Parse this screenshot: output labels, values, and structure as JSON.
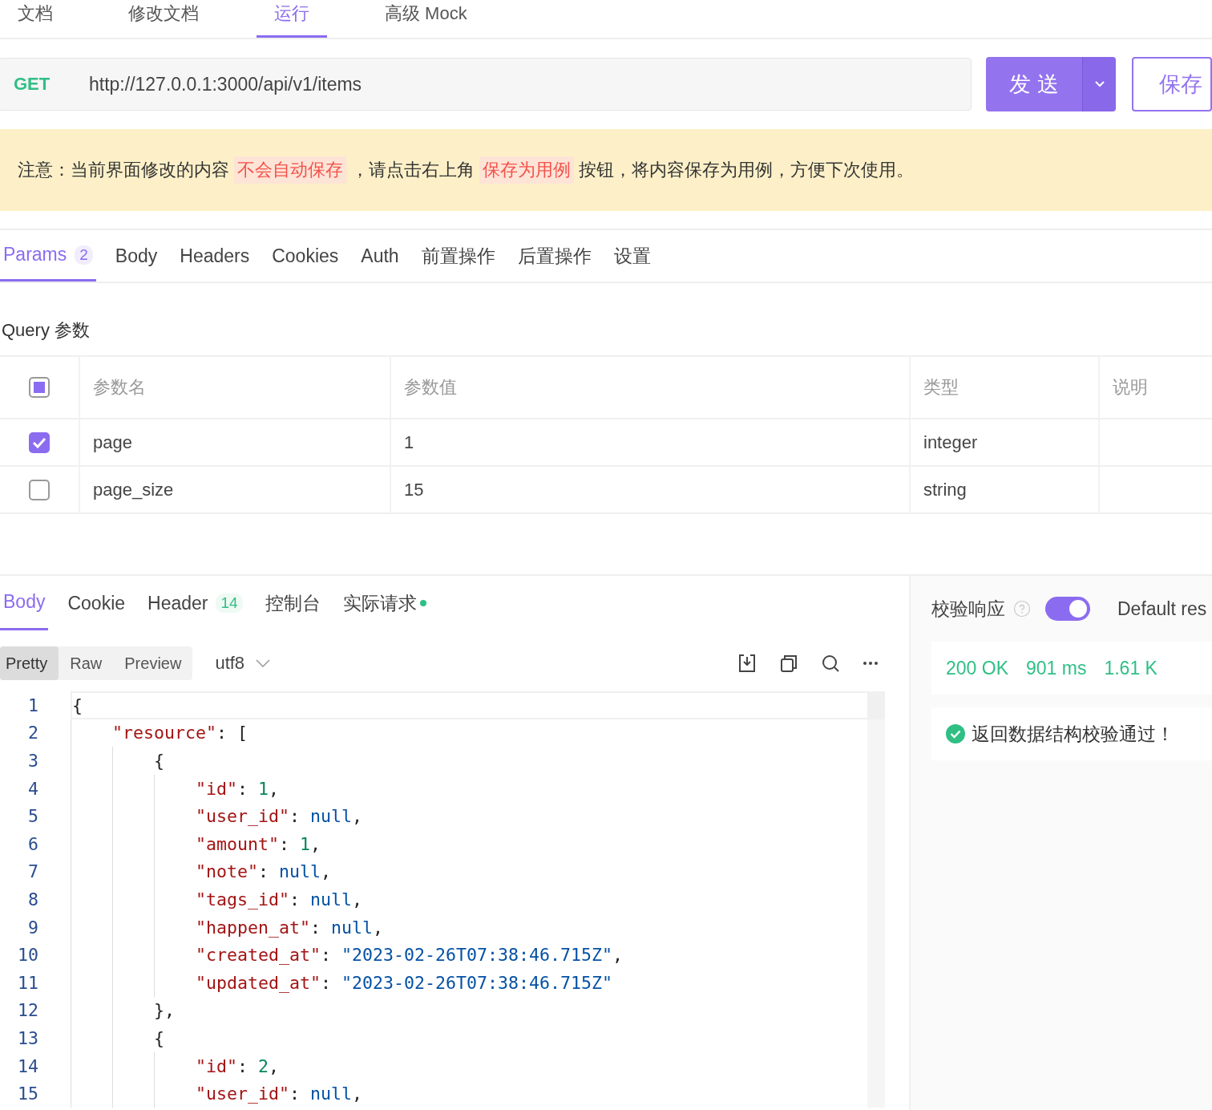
{
  "top_tabs": [
    {
      "label": "文档",
      "selected": false
    },
    {
      "label": "修改文档",
      "selected": false
    },
    {
      "label": "运行",
      "selected": true
    },
    {
      "label": "高级 Mock",
      "selected": false
    }
  ],
  "request": {
    "method": "GET",
    "url": "http://127.0.0.1:3000/api/v1/items",
    "send": "发 送",
    "save": "保存"
  },
  "notice": {
    "parts": [
      {
        "text": "注意：当前界面修改的内容",
        "kind": "plain"
      },
      {
        "text": "不会自动保存",
        "kind": "highlight"
      },
      {
        "text": "，请点击右上角",
        "kind": "plain"
      },
      {
        "text": "保存为用例",
        "kind": "highlight"
      },
      {
        "text": "按钮，将内容保存为用例，方便下次使用。",
        "kind": "plain"
      }
    ]
  },
  "request_tabs": [
    {
      "label": "Params",
      "count": "2",
      "selected": true
    },
    {
      "label": "Body",
      "selected": false
    },
    {
      "label": "Headers",
      "selected": false
    },
    {
      "label": "Cookies",
      "selected": false
    },
    {
      "label": "Auth",
      "selected": false
    },
    {
      "label": "前置操作",
      "selected": false
    },
    {
      "label": "后置操作",
      "selected": false
    },
    {
      "label": "设置",
      "selected": false
    }
  ],
  "query": {
    "title": "Query 参数",
    "select_all": {
      "indeterminate": true
    },
    "columns": [
      "参数名",
      "参数值",
      "类型",
      "说明"
    ],
    "rows": [
      {
        "checked": true,
        "name": "page",
        "value": "1",
        "type": "integer"
      },
      {
        "checked": false,
        "name": "page_size",
        "value": "15",
        "type": "string"
      }
    ]
  },
  "response_tabs": [
    {
      "label": "Body",
      "selected": true
    },
    {
      "label": "Cookie",
      "selected": false
    },
    {
      "label": "Header",
      "count": "14",
      "selected": false
    },
    {
      "label": "控制台",
      "selected": false
    },
    {
      "label": "实际请求",
      "dot": true,
      "selected": false
    }
  ],
  "formats": [
    {
      "label": "Pretty",
      "selected": true
    },
    {
      "label": "Raw",
      "selected": false
    },
    {
      "label": "Preview",
      "selected": false
    }
  ],
  "encoding": "utf8",
  "code": [
    {
      "n": "1",
      "tokens": [
        {
          "t": "{",
          "kind": "punct"
        }
      ]
    },
    {
      "n": "2",
      "tokens": [
        {
          "t": "    \"resource\"",
          "kind": "key"
        },
        {
          "t": ": [",
          "kind": "punct"
        }
      ]
    },
    {
      "n": "3",
      "tokens": [
        {
          "t": "        {",
          "kind": "punct"
        }
      ]
    },
    {
      "n": "4",
      "tokens": [
        {
          "t": "            \"id\"",
          "kind": "key"
        },
        {
          "t": ": ",
          "kind": "punct"
        },
        {
          "t": "1",
          "kind": "num"
        },
        {
          "t": ",",
          "kind": "punct"
        }
      ]
    },
    {
      "n": "5",
      "tokens": [
        {
          "t": "            \"user_id\"",
          "kind": "key"
        },
        {
          "t": ": ",
          "kind": "punct"
        },
        {
          "t": "null",
          "kind": "null"
        },
        {
          "t": ",",
          "kind": "punct"
        }
      ]
    },
    {
      "n": "6",
      "tokens": [
        {
          "t": "            \"amount\"",
          "kind": "key"
        },
        {
          "t": ": ",
          "kind": "punct"
        },
        {
          "t": "1",
          "kind": "num"
        },
        {
          "t": ",",
          "kind": "punct"
        }
      ]
    },
    {
      "n": "7",
      "tokens": [
        {
          "t": "            \"note\"",
          "kind": "key"
        },
        {
          "t": ": ",
          "kind": "punct"
        },
        {
          "t": "null",
          "kind": "null"
        },
        {
          "t": ",",
          "kind": "punct"
        }
      ]
    },
    {
      "n": "8",
      "tokens": [
        {
          "t": "            \"tags_id\"",
          "kind": "key"
        },
        {
          "t": ": ",
          "kind": "punct"
        },
        {
          "t": "null",
          "kind": "null"
        },
        {
          "t": ",",
          "kind": "punct"
        }
      ]
    },
    {
      "n": "9",
      "tokens": [
        {
          "t": "            \"happen_at\"",
          "kind": "key"
        },
        {
          "t": ": ",
          "kind": "punct"
        },
        {
          "t": "null",
          "kind": "null"
        },
        {
          "t": ",",
          "kind": "punct"
        }
      ]
    },
    {
      "n": "10",
      "tokens": [
        {
          "t": "            \"created_at\"",
          "kind": "key"
        },
        {
          "t": ": ",
          "kind": "punct"
        },
        {
          "t": "\"2023-02-26T07:38:46.715Z\"",
          "kind": "str"
        },
        {
          "t": ",",
          "kind": "punct"
        }
      ]
    },
    {
      "n": "11",
      "tokens": [
        {
          "t": "            \"updated_at\"",
          "kind": "key"
        },
        {
          "t": ": ",
          "kind": "punct"
        },
        {
          "t": "\"2023-02-26T07:38:46.715Z\"",
          "kind": "str"
        }
      ]
    },
    {
      "n": "12",
      "tokens": [
        {
          "t": "        },",
          "kind": "punct"
        }
      ]
    },
    {
      "n": "13",
      "tokens": [
        {
          "t": "        {",
          "kind": "punct"
        }
      ]
    },
    {
      "n": "14",
      "tokens": [
        {
          "t": "            \"id\"",
          "kind": "key"
        },
        {
          "t": ": ",
          "kind": "punct"
        },
        {
          "t": "2",
          "kind": "num"
        },
        {
          "t": ",",
          "kind": "punct"
        }
      ]
    },
    {
      "n": "15",
      "tokens": [
        {
          "t": "            \"user_id\"",
          "kind": "key"
        },
        {
          "t": ": ",
          "kind": "punct"
        },
        {
          "t": "null",
          "kind": "null"
        },
        {
          "t": ",",
          "kind": "punct"
        }
      ]
    }
  ],
  "validation": {
    "label": "校验响应",
    "on": true,
    "scheme": "Default res"
  },
  "status": [
    "200 OK",
    "901 ms",
    "1.61 K"
  ],
  "result": {
    "ok": true,
    "message": "返回数据结构校验通过！"
  }
}
